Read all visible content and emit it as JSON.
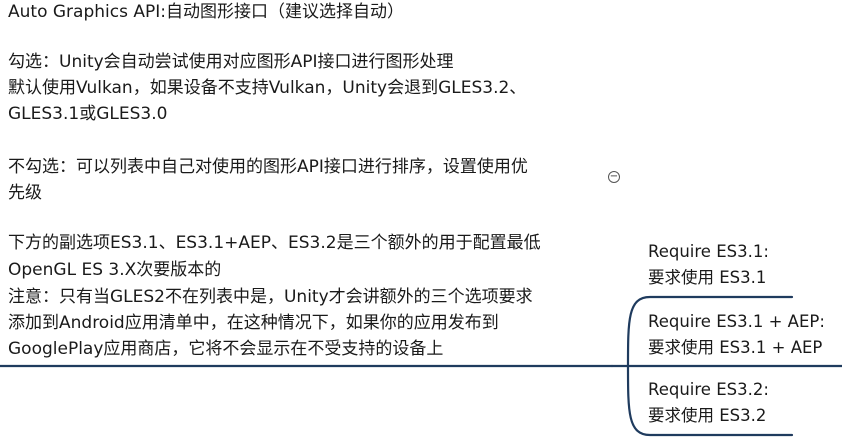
{
  "main": {
    "title": "Auto Graphics API:自动图形接口（建议选择自动）",
    "checked_line1": "勾选：Unity会自动尝试使用对应图形API接口进行图形处理",
    "checked_line2": "默认使用Vulkan，如果设备不支持Vulkan，Unity会退到GLES3.2、",
    "checked_line3": "GLES3.1或GLES3.0",
    "unchecked_line1": "不勾选：可以列表中自己对使用的图形API接口进行排序，设置使用优",
    "unchecked_line2": "先级",
    "sub_line1": "下方的副选项ES3.1、ES3.1+AEP、ES3.2是三个额外的用于配置最低",
    "sub_line2": "OpenGL ES 3.X次要版本的",
    "note_line1": "注意：只有当GLES2不在列表中是，Unity才会讲额外的三个选项要求",
    "note_line2": "添加到Android应用清单中，在这种情况下，如果你的应用发布到",
    "note_line3": "GooglePlay应用商店，它将不会显示在不受支持的设备上",
    "collapse_glyph": "−"
  },
  "branches": [
    {
      "line1": "Require ES3.1:",
      "line2": "要求使用 ES3.1"
    },
    {
      "line1": "Require ES3.1 + AEP:",
      "line2": "要求使用 ES3.1 + AEP"
    },
    {
      "line1": "Require ES3.2:",
      "line2": "要求使用 ES3.2"
    }
  ],
  "colors": {
    "connector": "#1f3b5e",
    "text": "#1a1a1a"
  }
}
